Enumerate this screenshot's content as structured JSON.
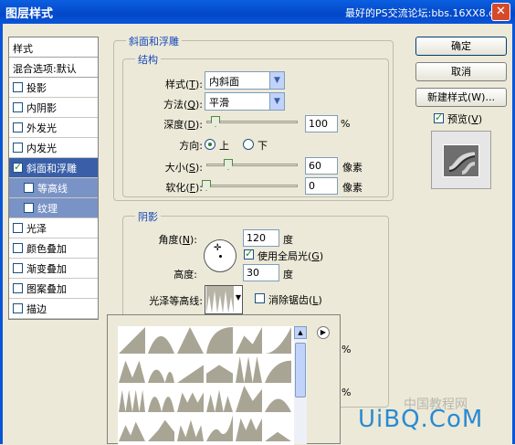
{
  "window": {
    "title": "图层样式",
    "banner": "最好的PS交流论坛:bbs.16XX8.com",
    "close_label": "✕"
  },
  "styles_panel": {
    "header": "样式",
    "blend_options": "混合选项:默认",
    "items": [
      {
        "label": "投影",
        "checked": false
      },
      {
        "label": "内阴影",
        "checked": false
      },
      {
        "label": "外发光",
        "checked": false
      },
      {
        "label": "内发光",
        "checked": false
      },
      {
        "label": "斜面和浮雕",
        "checked": true,
        "selected": true
      },
      {
        "label": "等高线",
        "checked": false,
        "sub": true
      },
      {
        "label": "纹理",
        "checked": false,
        "sub": true
      },
      {
        "label": "光泽",
        "checked": false
      },
      {
        "label": "颜色叠加",
        "checked": false
      },
      {
        "label": "渐变叠加",
        "checked": false
      },
      {
        "label": "图案叠加",
        "checked": false
      },
      {
        "label": "描边",
        "checked": false
      }
    ]
  },
  "bevel": {
    "group_title": "斜面和浮雕",
    "structure_title": "结构",
    "style_label": "样式(",
    "style_key": "T",
    "style_value": "内斜面",
    "technique_label": "方法(",
    "technique_key": "Q",
    "technique_value": "平滑",
    "depth_label": "深度(",
    "depth_key": "D",
    "depth_value": "100",
    "depth_unit": "%",
    "direction_label": "方向:",
    "direction_up": "上",
    "direction_down": "下",
    "size_label": "大小(",
    "size_key": "S",
    "size_value": "60",
    "size_unit": "像素",
    "soften_label": "软化(",
    "soften_key": "F",
    "soften_value": "0",
    "soften_unit": "像素",
    "depth_level": 0.1,
    "size_level": 0.24,
    "soften_level": 0
  },
  "shading": {
    "title": "阴影",
    "angle_label": "角度(",
    "angle_key": "N",
    "angle_value": "120",
    "angle_unit": "度",
    "global_light_label": "使用全局光(",
    "global_light_key": "G",
    "altitude_label": "高度:",
    "altitude_value": "30",
    "altitude_unit": "度",
    "gloss_contour_label": "光泽等高线:",
    "antialias_label": "消除锯齿(",
    "antialias_key": "L"
  },
  "buttons": {
    "ok": "确定",
    "cancel": "取消",
    "new_style": "新建样式(W)...",
    "preview_label": "预览(",
    "preview_key": "V"
  },
  "popup": {
    "percent_1": "%",
    "percent_2": "%"
  },
  "watermark": {
    "text": "UiBQ.CoM",
    "small": "中国教程网"
  }
}
